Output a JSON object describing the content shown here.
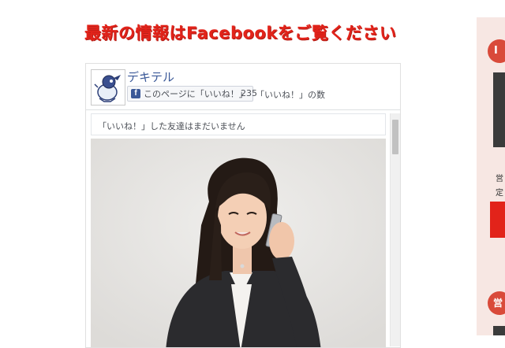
{
  "headline": "最新の情報はFacebookをご覧ください",
  "facebook_widget": {
    "page_name": "デキテル",
    "like_button_label": "このページに「いいね！」",
    "like_count": "235",
    "like_count_label": "「いいね！」の数",
    "friends_notice": "「いいね！」した友達はまだいません",
    "brand_color": "#3b5998",
    "image_subject": "woman in business suit talking on mobile phone"
  },
  "sidebar": {
    "badge_1": "I",
    "text_1": "営",
    "text_2": "定",
    "badge_2": "営",
    "accent_color": "#e2231a"
  }
}
